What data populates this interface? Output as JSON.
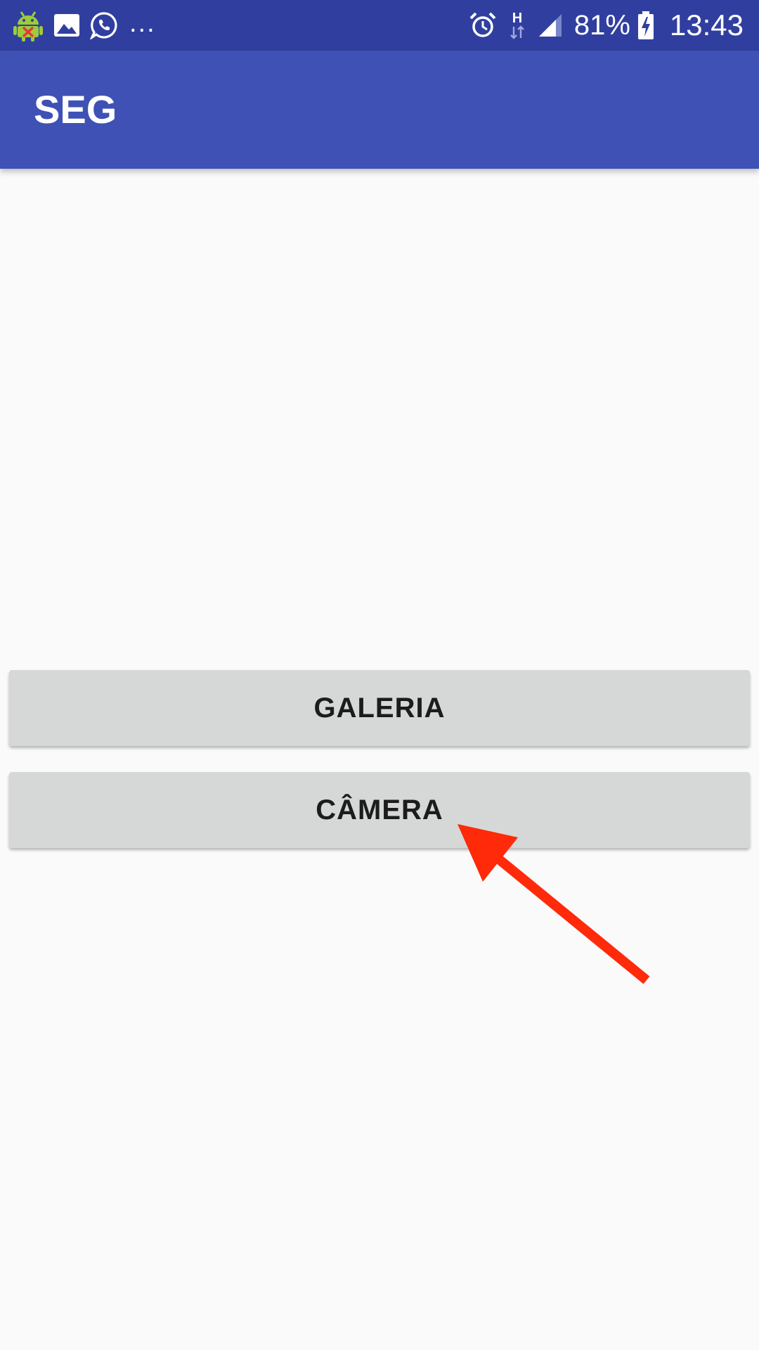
{
  "status_bar": {
    "notification_icons": [
      "android-debug-icon",
      "image-icon",
      "whatsapp-icon"
    ],
    "overflow": "...",
    "network_type": "H",
    "battery_percent": "81%",
    "time": "13:43"
  },
  "app_bar": {
    "title": "SEG"
  },
  "buttons": {
    "gallery_label": "GALERIA",
    "camera_label": "CÂMERA"
  },
  "colors": {
    "status_bar": "#303f9f",
    "app_bar": "#3f51b5",
    "background": "#fafafa",
    "button": "#d6d7d7",
    "annotation_arrow": "#ff2a0a"
  }
}
